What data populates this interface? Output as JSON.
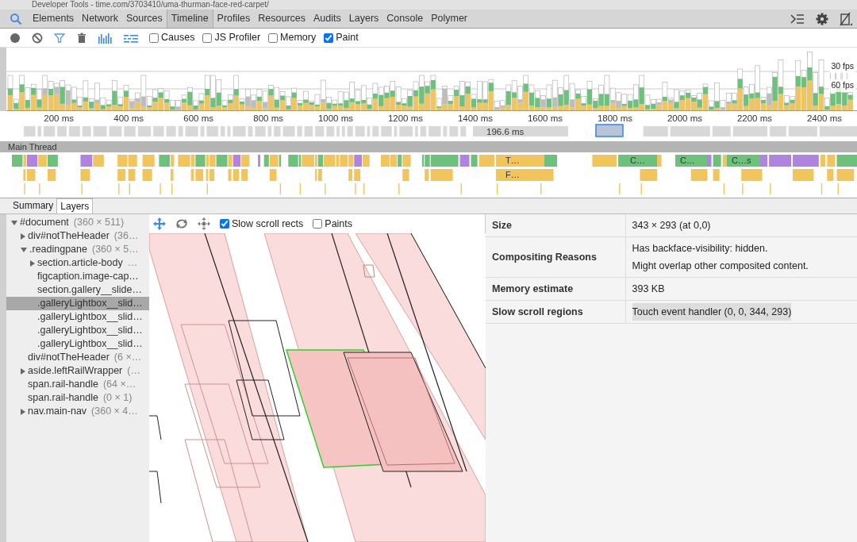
{
  "window": {
    "title": "Developer Tools - time.com/3703410/uma-thurman-face-red-carpet/"
  },
  "tabs": [
    {
      "label": "Elements",
      "selected": false
    },
    {
      "label": "Network",
      "selected": false
    },
    {
      "label": "Sources",
      "selected": false
    },
    {
      "label": "Timeline",
      "selected": true
    },
    {
      "label": "Profiles",
      "selected": false
    },
    {
      "label": "Resources",
      "selected": false
    },
    {
      "label": "Audits",
      "selected": false
    },
    {
      "label": "Layers",
      "selected": false
    },
    {
      "label": "Console",
      "selected": false
    },
    {
      "label": "Polymer",
      "selected": false
    }
  ],
  "toolbar": {
    "checkboxes": [
      {
        "label": "Causes",
        "checked": false
      },
      {
        "label": "JS Profiler",
        "checked": false
      },
      {
        "label": "Memory",
        "checked": false
      },
      {
        "label": "Paint",
        "checked": true
      }
    ]
  },
  "overview": {
    "fps_labels": [
      "30 fps",
      "60 fps"
    ],
    "ticks": [
      "200 ms",
      "400 ms",
      "600 ms",
      "800 ms",
      "1000 ms",
      "1200 ms",
      "1400 ms",
      "1600 ms",
      "1800 ms",
      "2000 ms",
      "2200 ms",
      "2400 ms"
    ],
    "frame_duration": "196.6 ms"
  },
  "main_thread": {
    "title": "Main Thread",
    "event_labels": [
      "T…",
      "F…",
      "C…",
      "C…",
      "C…s"
    ]
  },
  "bottom_tabs": [
    {
      "label": "Summary",
      "selected": false
    },
    {
      "label": "Layers",
      "selected": true
    }
  ],
  "layer_tree": [
    {
      "label": "#document",
      "detail": "(360 × 511)",
      "expanded": true,
      "selected": false,
      "children": [
        {
          "label": "div#notTheHeader",
          "detail": "(36…",
          "expanded": false,
          "selected": false
        },
        {
          "label": ".readingpane",
          "detail": "(360 × 5…",
          "expanded": true,
          "selected": false,
          "children": [
            {
              "label": "section.article-body",
              "detail": "…",
              "expanded": false,
              "selected": false
            },
            {
              "label": "figcaption.image-cap…",
              "selected": false
            },
            {
              "label": "section.gallery__slide…",
              "selected": false
            },
            {
              "label": ".galleryLightbox__slid…",
              "selected": true
            },
            {
              "label": ".galleryLightbox__slid…",
              "selected": false
            },
            {
              "label": ".galleryLightbox__slid…",
              "selected": false
            },
            {
              "label": ".galleryLightbox__slid…",
              "selected": false
            }
          ]
        },
        {
          "label": "div#notTheHeader",
          "detail": "(6 ×…",
          "selected": false
        },
        {
          "label": "aside.leftRailWrapper",
          "detail": "(…",
          "expanded": false,
          "selected": false
        },
        {
          "label": "span.rail-handle",
          "detail": "(64 ×…",
          "selected": false
        },
        {
          "label": "span.rail-handle",
          "detail": "(0 × 1)",
          "selected": false
        },
        {
          "label": "nav.main-nav",
          "detail": "(360 × 4…",
          "expanded": false,
          "selected": false
        }
      ]
    }
  ],
  "viewer_toolbar": {
    "tools": [
      {
        "kind": "pan",
        "selected": true
      },
      {
        "kind": "rotate",
        "selected": false
      },
      {
        "kind": "reset",
        "selected": false
      }
    ],
    "checkboxes": [
      {
        "label": "Slow scroll rects",
        "checked": true
      },
      {
        "label": "Paints",
        "checked": false
      }
    ]
  },
  "details": [
    {
      "label": "Size",
      "values": [
        "343 × 293 (at 0,0)"
      ],
      "highlighted": false
    },
    {
      "label": "Compositing Reasons",
      "values": [
        "Has backface-visibility: hidden.",
        "Might overlap other composited content."
      ],
      "highlighted": false
    },
    {
      "label": "Memory estimate",
      "values": [
        "393 KB"
      ],
      "highlighted": false
    },
    {
      "label": "Slow scroll regions",
      "values": [
        "Touch event handler (0, 0, 344, 293)"
      ],
      "highlighted": true
    }
  ]
}
